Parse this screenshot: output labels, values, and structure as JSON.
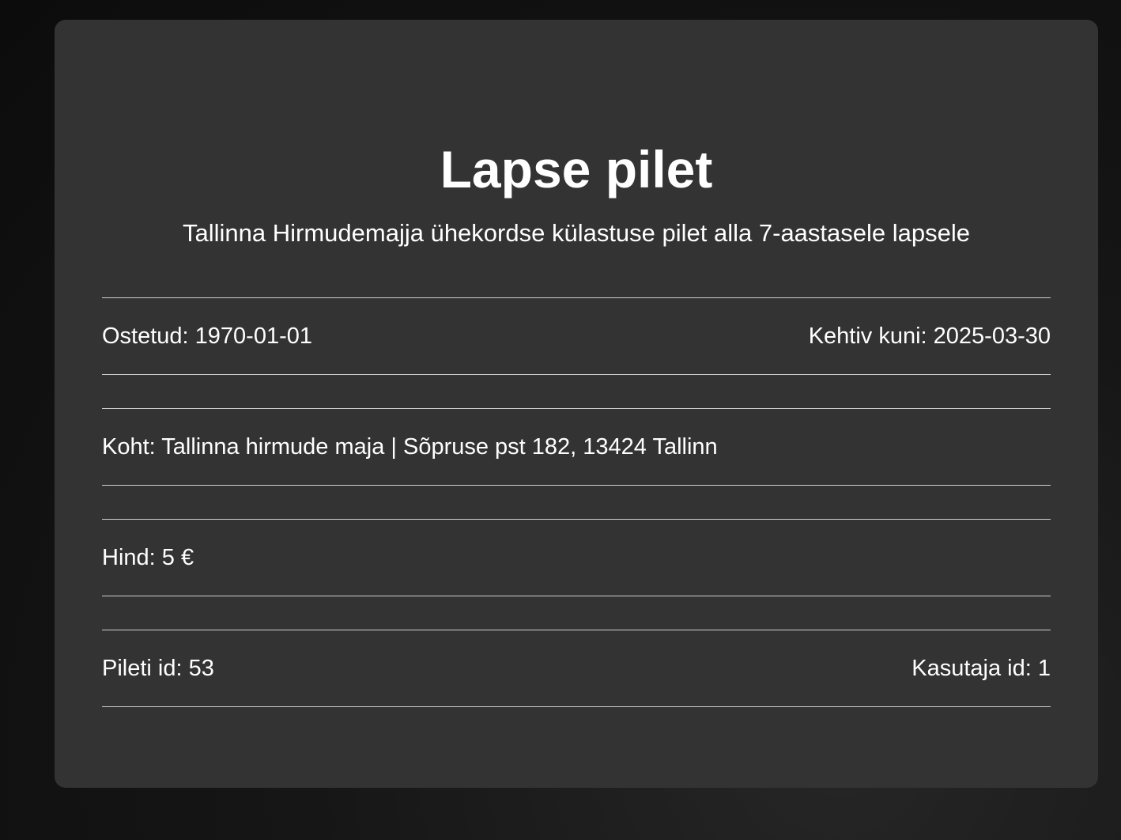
{
  "ticket": {
    "title": "Lapse pilet",
    "description": "Tallinna Hirmudemajja ühekordse külastuse pilet alla 7-aastasele lapsele",
    "purchased": "Ostetud: 1970-01-01",
    "valid_until": "Kehtiv kuni: 2025-03-30",
    "location": "Koht: Tallinna hirmude maja | Sõpruse pst 182, 13424 Tallinn",
    "price": "Hind: 5 €",
    "ticket_id": "Pileti id: 53",
    "user_id": "Kasutaja id: 1"
  },
  "colors": {
    "page_background": "#111111",
    "card_background": "#333333",
    "text": "#ffffff",
    "divider": "#cfcfcf"
  }
}
